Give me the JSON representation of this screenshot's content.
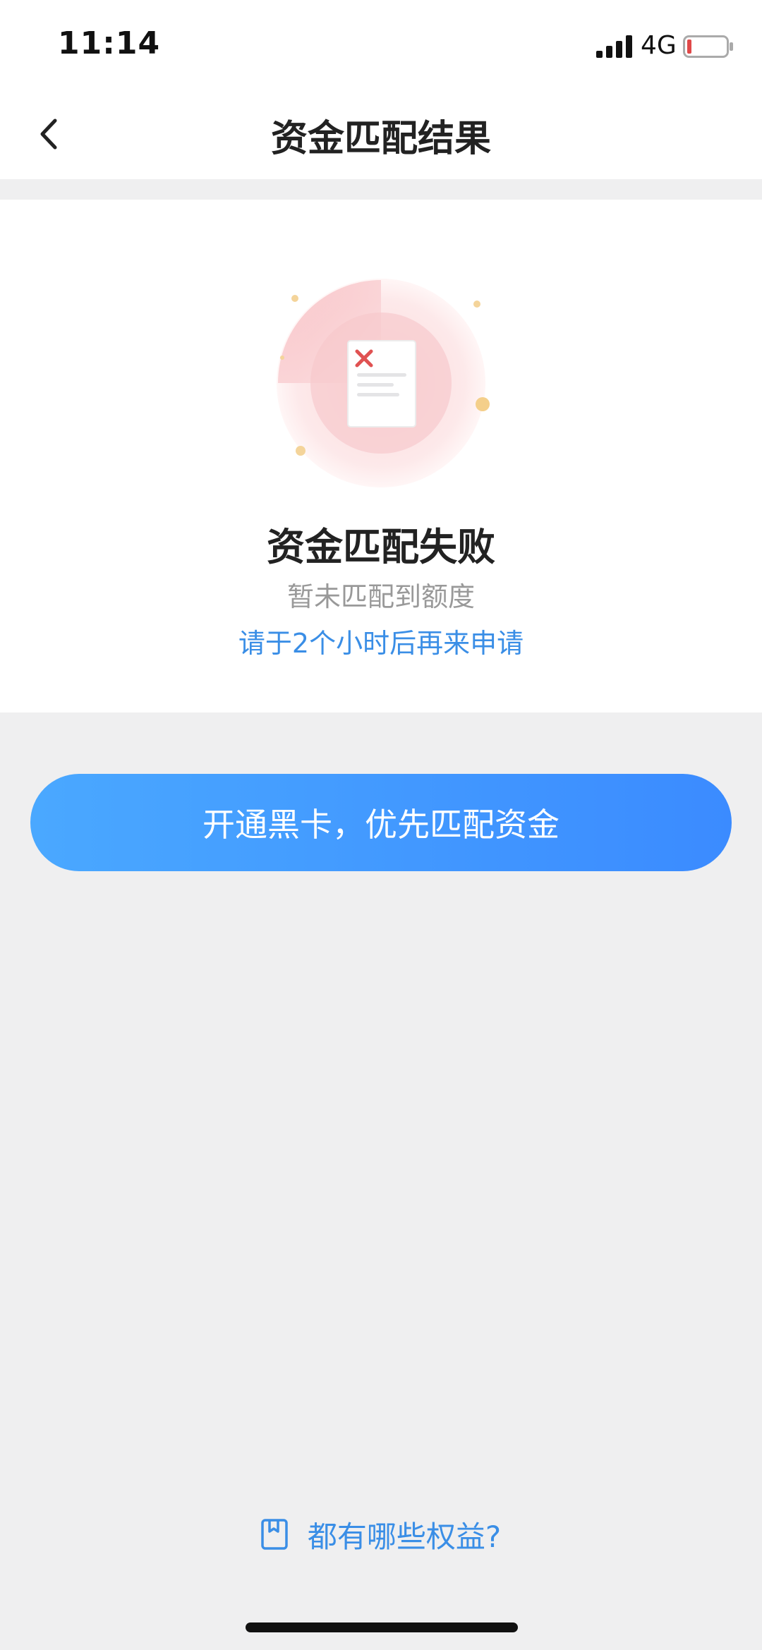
{
  "status_bar": {
    "time": "11:14",
    "network": "4G",
    "icons": [
      "signal-icon",
      "battery-icon"
    ],
    "battery_color": "#e04848"
  },
  "nav": {
    "title": "资金匹配结果",
    "back_icon": "chevron-left-icon"
  },
  "result": {
    "icon": "document-error-icon",
    "title": "资金匹配失败",
    "subtitle": "暂未匹配到额度",
    "hint": "请于2个小时后再来申请"
  },
  "primary_action": {
    "label": "开通黑卡，优先匹配资金"
  },
  "benefits_link": {
    "icon": "book-icon",
    "label": "都有哪些权益?"
  },
  "colors": {
    "accent_blue": "#3a8ee6",
    "button_gradient_start": "#4aa8ff",
    "button_gradient_end": "#3b8bff",
    "error_red": "#e05252",
    "page_background": "#efeff0"
  }
}
